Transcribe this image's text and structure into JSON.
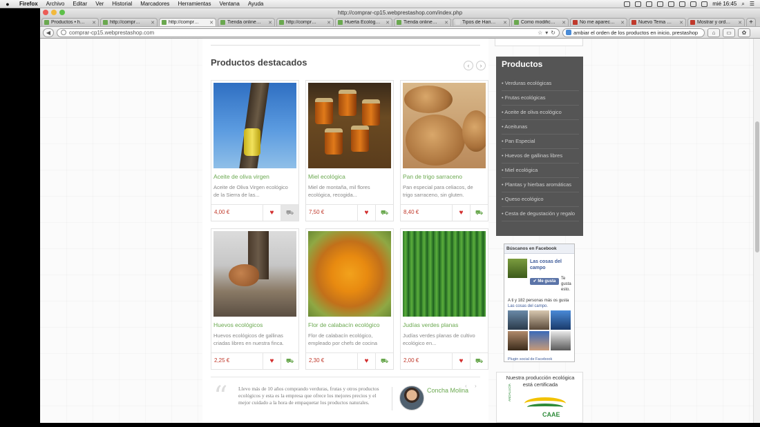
{
  "menubar": {
    "app": "Firefox",
    "items": [
      "Archivo",
      "Editar",
      "Ver",
      "Historial",
      "Marcadores",
      "Herramientas",
      "Ventana",
      "Ayuda"
    ],
    "clock": "mié 16:45"
  },
  "window": {
    "title": "http://comprar-cp15.webprestashop.com/index.php",
    "tabs": [
      {
        "label": "Productos • h…",
        "color": "#6aa84f"
      },
      {
        "label": "http://compr…",
        "color": "#6aa84f"
      },
      {
        "label": "http://compr…",
        "color": "#6aa84f",
        "active": true
      },
      {
        "label": "Tienda online…",
        "color": "#6aa84f"
      },
      {
        "label": "http://compr…",
        "color": "#6aa84f"
      },
      {
        "label": "Huerta Ecológ…",
        "color": "#6aa84f"
      },
      {
        "label": "Tienda online…",
        "color": "#6aa84f"
      },
      {
        "label": "Tipos de Hari…",
        "color": "#dddddd"
      },
      {
        "label": "Como modific…",
        "color": "#6aa84f"
      },
      {
        "label": "No me aparec…",
        "color": "#c0392b"
      },
      {
        "label": "Nuevo Tema …",
        "color": "#c0392b"
      },
      {
        "label": "Mostrar y ord…",
        "color": "#c0392b"
      }
    ],
    "newtab": "+",
    "url": "comprar-cp15.webprestashop.com",
    "search": "ambiar el orden de los productos en inicio, prestashop"
  },
  "page": {
    "section_title": "Productos destacados",
    "carousel_prev": "‹",
    "carousel_next": "›",
    "products": [
      {
        "name": "Aceite de oliva virgen",
        "desc": "Aceite de Oliva Virgen ecológico de la Sierra de las...",
        "price": "4,00 €",
        "image": "olive-oil"
      },
      {
        "name": "Miel ecológica",
        "desc": "Miel de montaña, mil flores ecológica, recogida...",
        "price": "7,50 €",
        "image": "honey"
      },
      {
        "name": "Pan de trigo sarraceno",
        "desc": "Pan especial para celiacos, de trigo sarraceno, sin gluten.",
        "price": "8,40 €",
        "image": "bread"
      },
      {
        "name": "Huevos ecológicos",
        "desc": "Huevos ecológicos de gallinas criadas libres en nuestra finca.",
        "price": "2,25 €",
        "image": "hen"
      },
      {
        "name": "Flor de calabacín ecológico",
        "desc": "Flor de calabacín ecológico, empleado por chefs de cocina",
        "price": "2,30 €",
        "image": "zucchini-flower"
      },
      {
        "name": "Judías verdes planas",
        "desc": "Judías verdes planas de cultivo ecológico en...",
        "price": "2,00 €",
        "image": "green-beans"
      }
    ],
    "testimonial": {
      "text": "Llevo más de 10 años comprando verduras, frutas y otros productos ecológicos y esta es la empresa que ofrece los mejores precios y el mejor cuidado a la hora de empaquetar los productos naturales.",
      "author": "Concha Molina"
    }
  },
  "sidebar": {
    "title": "Productos",
    "items": [
      "Verduras ecológicas",
      "Frutas ecológicas",
      "Aceite de oliva ecológico",
      "Aceitunas",
      "Pan Especial",
      "Huevos de gallinas libres",
      "Miel ecológica",
      "Plantas y hierbas aromáticas",
      "Queso ecológico",
      "Cesta de degustación y regalo"
    ],
    "facebook": {
      "header": "Búscanos en Facebook",
      "page_name": "Las cosas del campo",
      "like_button": "✔ Me gusta",
      "like_note": "Te gusta esto.",
      "count_text": "A ti y 182 personas más os gusta",
      "count_link": "Las cosas del campo.",
      "plugin": "Plugin social de Facebook"
    },
    "certification": {
      "title": "Nuestra producción ecológica está certificada",
      "logo_text": "CAAE",
      "vertical_text": "ANDALUCÍA"
    }
  }
}
